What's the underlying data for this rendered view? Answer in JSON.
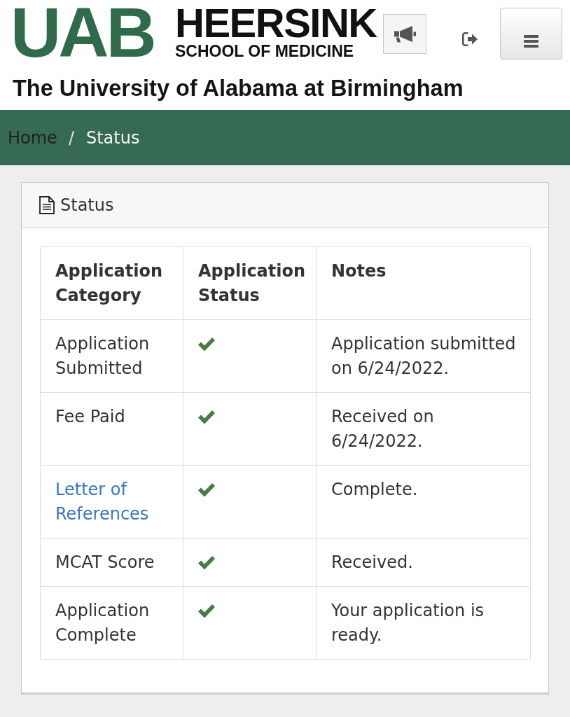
{
  "header": {
    "logo": "UAB",
    "brand_name": "HEERSINK",
    "brand_subtitle": "SCHOOL OF MEDICINE",
    "university": "The University of Alabama at Birmingham"
  },
  "breadcrumb": {
    "separator": "/",
    "items": [
      {
        "label": "Home",
        "current": false
      },
      {
        "label": "Status",
        "current": true
      }
    ]
  },
  "panel": {
    "title": "Status",
    "table": {
      "columns": [
        "Application Category",
        "Application Status",
        "Notes"
      ],
      "rows": [
        {
          "category": "Application Submitted",
          "link": false,
          "checked": true,
          "notes": "Application submitted on 6/24/2022."
        },
        {
          "category": "Fee Paid",
          "link": false,
          "checked": true,
          "notes": "Received on 6/24/2022."
        },
        {
          "category": "Letter of References",
          "link": true,
          "checked": true,
          "notes": "Complete."
        },
        {
          "category": "MCAT Score",
          "link": false,
          "checked": true,
          "notes": "Received."
        },
        {
          "category": "Application Complete",
          "link": false,
          "checked": true,
          "notes": "Your application is ready."
        }
      ]
    }
  }
}
